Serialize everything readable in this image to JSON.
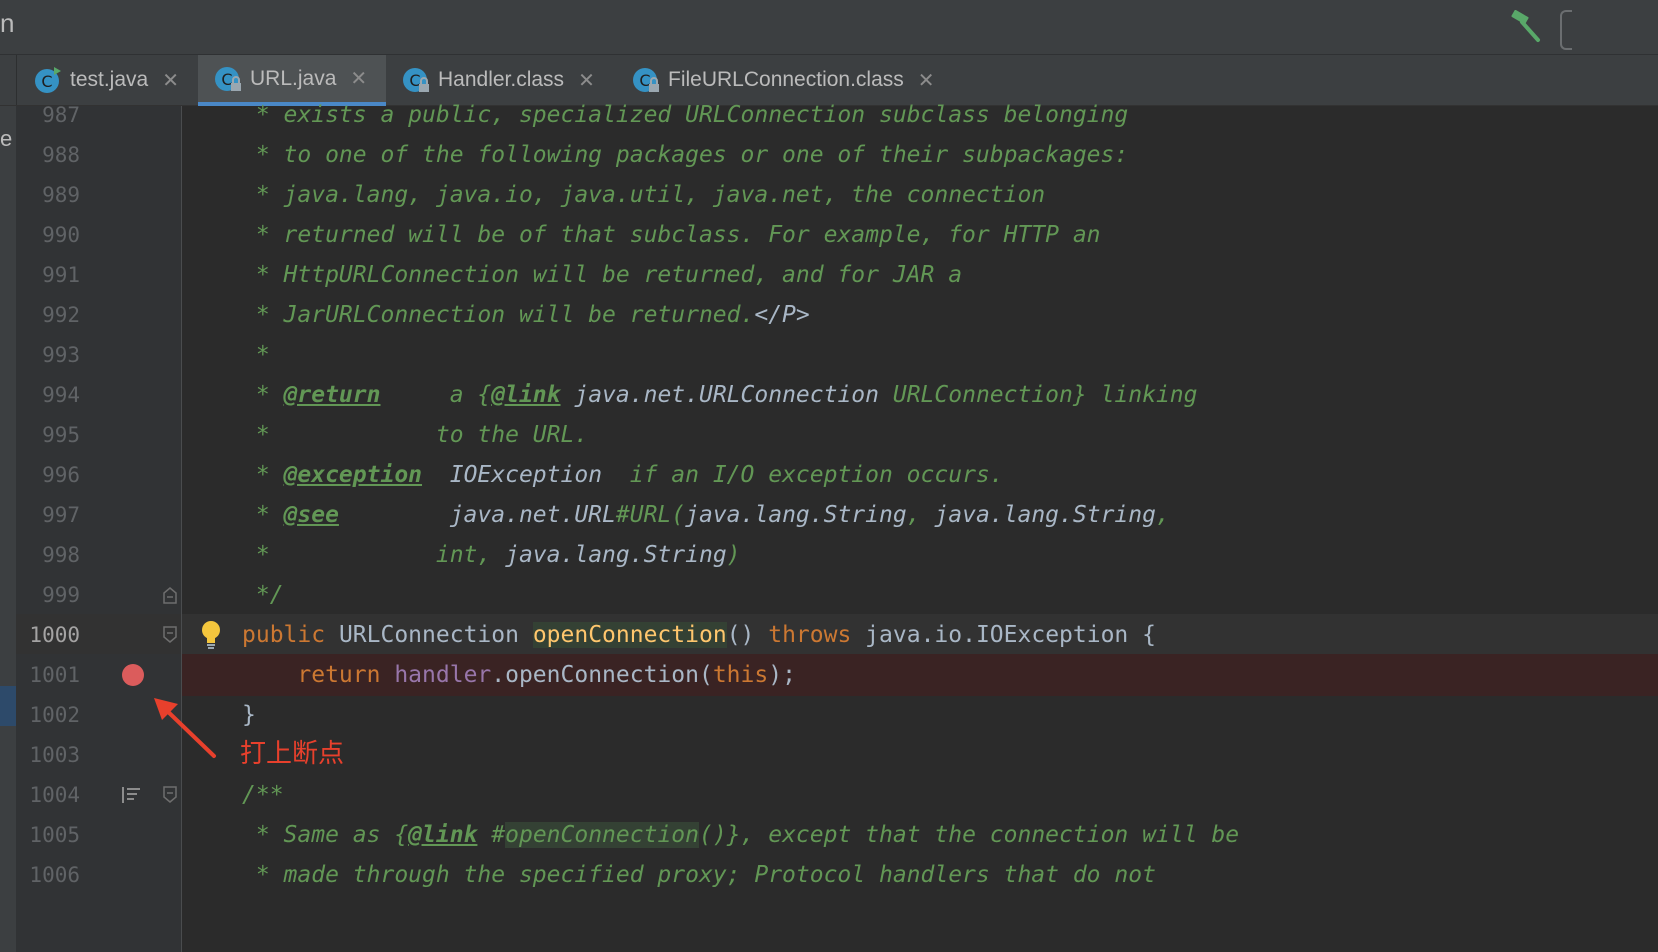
{
  "window": {
    "title_fragment": "n",
    "side_label_fragment": "e"
  },
  "tabs": [
    {
      "label": "test.java",
      "icon": "java-class-run-icon",
      "active": false
    },
    {
      "label": "URL.java",
      "icon": "java-class-locked-icon",
      "active": true
    },
    {
      "label": "Handler.class",
      "icon": "class-locked-icon",
      "active": false
    },
    {
      "label": "FileURLConnection.class",
      "icon": "class-locked-icon",
      "active": false
    }
  ],
  "editor": {
    "lines": [
      {
        "num": "987"
      },
      {
        "num": "988"
      },
      {
        "num": "989"
      },
      {
        "num": "990"
      },
      {
        "num": "991"
      },
      {
        "num": "992"
      },
      {
        "num": "993"
      },
      {
        "num": "994"
      },
      {
        "num": "995"
      },
      {
        "num": "996"
      },
      {
        "num": "997"
      },
      {
        "num": "998"
      },
      {
        "num": "999"
      },
      {
        "num": "1000"
      },
      {
        "num": "1001"
      },
      {
        "num": "1002"
      },
      {
        "num": "1003"
      },
      {
        "num": "1004"
      },
      {
        "num": "1005"
      },
      {
        "num": "1006"
      }
    ],
    "code": {
      "l987": " * exists a public, specialized URLConnection subclass belonging",
      "l988": " * to one of the following packages or one of their subpackages:",
      "l989": " * java.lang, java.io, java.util, java.net, the connection",
      "l990": " * returned will be of that subclass. For example, for HTTP an",
      "l991": " * HttpURLConnection will be returned, and for JAR a",
      "l992a": " * JarURLConnection will be returned.",
      "l992b": "</P>",
      "l993": " *",
      "l994a": " * ",
      "l994tag": "@return",
      "l994b": "     a {",
      "l994link": "@link",
      "l994ref": " java.net.URLConnection",
      "l994c": " URLConnection} linking",
      "l995": " *            to the URL.",
      "l996a": " * ",
      "l996tag": "@exception",
      "l996ref": "  IOException",
      "l996b": "  if an I/O exception occurs.",
      "l997a": " * ",
      "l997tag": "@see",
      "l997ref1": "        java.net.URL",
      "l997b": "#URL(",
      "l997ref2": "java.lang.String",
      "l997c": ", ",
      "l997ref3": "java.lang.String",
      "l997d": ",",
      "l998a": " *            int, ",
      "l998ref": "java.lang.String",
      "l998b": ")",
      "l999": " */",
      "l1000_kw1": "public",
      "l1000_type": " URLConnection ",
      "l1000_fn": "openConnection",
      "l1000_p": "() ",
      "l1000_kw2": "throws",
      "l1000_rest": " java.io.IOException {",
      "l1001_kw": "    return ",
      "l1001_fld": "handler",
      "l1001_call": ".openConnection(",
      "l1001_this": "this",
      "l1001_end": ");",
      "l1002": "}",
      "l1004": "/**",
      "l1005a": " * Same as {",
      "l1005link": "@link",
      "l1005b": " #",
      "l1005hl": "openConnection",
      "l1005c": "()}, except that the connection will be",
      "l1006": " * made through the specified proxy; Protocol handlers that do not"
    }
  },
  "annotation": {
    "text": "打上断点",
    "color": "#e8402c"
  },
  "colors": {
    "background": "#2b2b2b",
    "comment": "#629755",
    "keyword": "#cc7832",
    "method": "#ffc66d",
    "field": "#9876aa",
    "breakpoint": "#db5c5c",
    "active_tab_underline": "#4a88c7"
  }
}
